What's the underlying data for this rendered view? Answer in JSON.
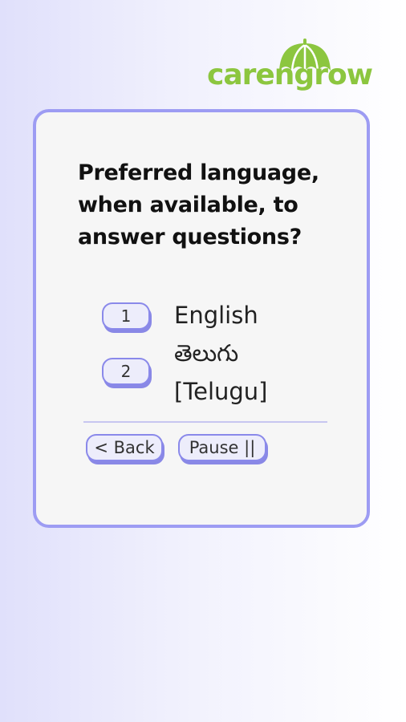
{
  "brand": {
    "logo_text": "carengrow",
    "logo_color": "#8cc63f",
    "icon": "umbrella-icon"
  },
  "question": {
    "text": "Preferred language, when available, to answer questions?"
  },
  "options": [
    {
      "number": "1",
      "label_line1": "English",
      "label_line2": ""
    },
    {
      "number": "2",
      "label_line1": "తెలుగు",
      "label_line2": "[Telugu]"
    }
  ],
  "nav": {
    "back_label": "< Back",
    "pause_label": "Pause ||"
  },
  "colors": {
    "accent": "#9d9cf3",
    "button_bg": "#ededfb",
    "card_bg": "#f6f6f6"
  }
}
